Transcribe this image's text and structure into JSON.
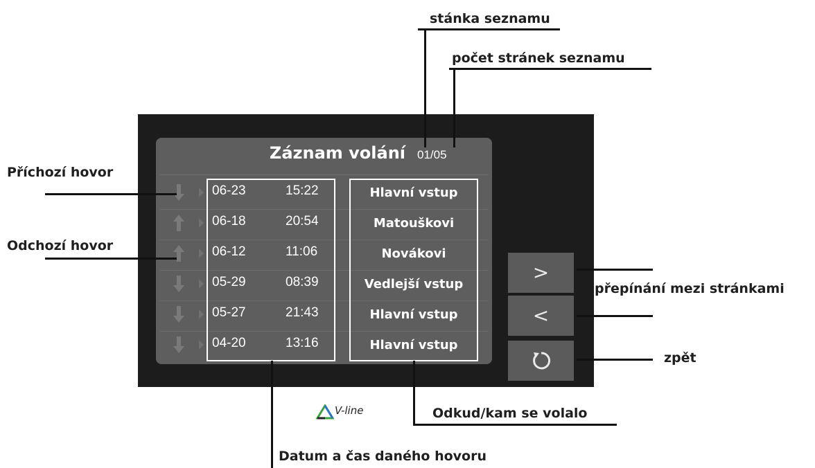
{
  "annotations": {
    "list_page": "stánka seznamu",
    "page_count": "počet stránek seznamu",
    "incoming_call": "Příchozí hovor",
    "outgoing_call": "Odchozí hovor",
    "page_switching": "přepínání mezi stránkami",
    "back": "zpět",
    "from_to": "Odkud/kam se volalo",
    "date_time": "Datum a čas daného hovoru"
  },
  "screen": {
    "title": "Záznam volání",
    "page_counter": "01/05"
  },
  "calls": [
    {
      "direction": "incoming",
      "date": "06-23",
      "time": "15:22",
      "place": "Hlavní vstup"
    },
    {
      "direction": "outgoing",
      "date": "06-18",
      "time": "20:54",
      "place": "Matouškovi"
    },
    {
      "direction": "outgoing",
      "date": "06-12",
      "time": "11:06",
      "place": "Novákovi"
    },
    {
      "direction": "incoming",
      "date": "05-29",
      "time": "08:39",
      "place": "Vedlejší vstup"
    },
    {
      "direction": "incoming",
      "date": "05-27",
      "time": "21:43",
      "place": "Hlavní vstup"
    },
    {
      "direction": "incoming",
      "date": "04-20",
      "time": "13:16",
      "place": "Hlavní vstup"
    }
  ],
  "buttons": {
    "next_icon": "chevron-right-icon",
    "prev_icon": "chevron-left-icon",
    "back_icon": "undo-circle-icon",
    "next_glyph": ">",
    "prev_glyph": "<"
  },
  "logo": {
    "text": "V-line"
  },
  "colors": {
    "device": "#1c1c1c",
    "screen": "#5e5e5e",
    "button": "#5b5b5b",
    "logo_green": "#3aa53a",
    "logo_blue": "#2a78c8"
  }
}
